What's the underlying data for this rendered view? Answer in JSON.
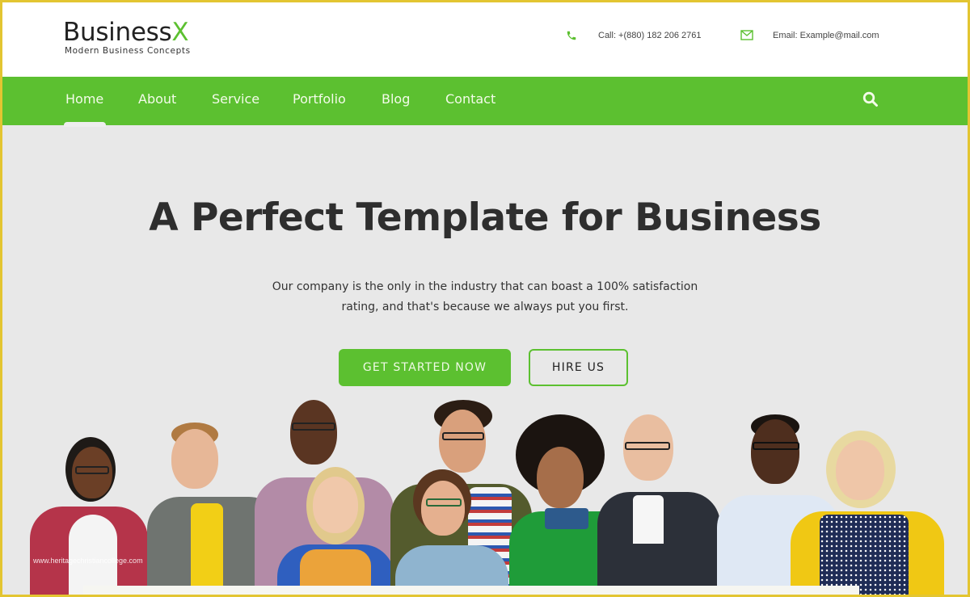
{
  "brand": {
    "name_main": "Business",
    "name_accent": "X",
    "tagline": "Modern Business Concepts",
    "accent_color": "#5cc030"
  },
  "contact": {
    "phone_icon": "phone-icon",
    "phone_text": "Call: +(880) 182 206 2761",
    "email_icon": "envelope-icon",
    "email_text": "Email: Example@mail.com"
  },
  "nav": {
    "items": [
      {
        "label": "Home",
        "active": true
      },
      {
        "label": "About",
        "active": false
      },
      {
        "label": "Service",
        "active": false
      },
      {
        "label": "Portfolio",
        "active": false
      },
      {
        "label": "Blog",
        "active": false
      },
      {
        "label": "Contact",
        "active": false
      }
    ],
    "search_icon": "search-icon",
    "background_color": "#5cc030"
  },
  "hero": {
    "title": "A Perfect Template for Business",
    "text_line1": "Our company is the only in the industry that can boast a 100% satisfaction",
    "text_line2": "rating, and that's because we always put you first.",
    "primary_button": "GET STARTED NOW",
    "secondary_button": "HIRE US",
    "image_alt": "Group of diverse smiling business people holding a blank sign"
  },
  "watermark": "www.heritagechristiancollege.com",
  "frame_color": "#e3c531"
}
